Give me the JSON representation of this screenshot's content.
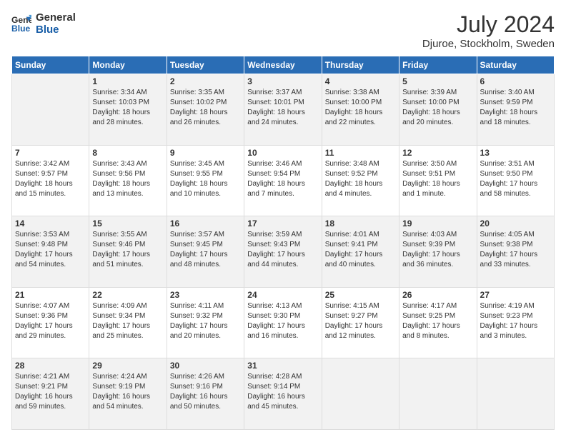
{
  "header": {
    "logo_line1": "General",
    "logo_line2": "Blue",
    "month_year": "July 2024",
    "location": "Djuroe, Stockholm, Sweden"
  },
  "days_of_week": [
    "Sunday",
    "Monday",
    "Tuesday",
    "Wednesday",
    "Thursday",
    "Friday",
    "Saturday"
  ],
  "weeks": [
    [
      {
        "day": "",
        "info": ""
      },
      {
        "day": "1",
        "info": "Sunrise: 3:34 AM\nSunset: 10:03 PM\nDaylight: 18 hours\nand 28 minutes."
      },
      {
        "day": "2",
        "info": "Sunrise: 3:35 AM\nSunset: 10:02 PM\nDaylight: 18 hours\nand 26 minutes."
      },
      {
        "day": "3",
        "info": "Sunrise: 3:37 AM\nSunset: 10:01 PM\nDaylight: 18 hours\nand 24 minutes."
      },
      {
        "day": "4",
        "info": "Sunrise: 3:38 AM\nSunset: 10:00 PM\nDaylight: 18 hours\nand 22 minutes."
      },
      {
        "day": "5",
        "info": "Sunrise: 3:39 AM\nSunset: 10:00 PM\nDaylight: 18 hours\nand 20 minutes."
      },
      {
        "day": "6",
        "info": "Sunrise: 3:40 AM\nSunset: 9:59 PM\nDaylight: 18 hours\nand 18 minutes."
      }
    ],
    [
      {
        "day": "7",
        "info": "Sunrise: 3:42 AM\nSunset: 9:57 PM\nDaylight: 18 hours\nand 15 minutes."
      },
      {
        "day": "8",
        "info": "Sunrise: 3:43 AM\nSunset: 9:56 PM\nDaylight: 18 hours\nand 13 minutes."
      },
      {
        "day": "9",
        "info": "Sunrise: 3:45 AM\nSunset: 9:55 PM\nDaylight: 18 hours\nand 10 minutes."
      },
      {
        "day": "10",
        "info": "Sunrise: 3:46 AM\nSunset: 9:54 PM\nDaylight: 18 hours\nand 7 minutes."
      },
      {
        "day": "11",
        "info": "Sunrise: 3:48 AM\nSunset: 9:52 PM\nDaylight: 18 hours\nand 4 minutes."
      },
      {
        "day": "12",
        "info": "Sunrise: 3:50 AM\nSunset: 9:51 PM\nDaylight: 18 hours\nand 1 minute."
      },
      {
        "day": "13",
        "info": "Sunrise: 3:51 AM\nSunset: 9:50 PM\nDaylight: 17 hours\nand 58 minutes."
      }
    ],
    [
      {
        "day": "14",
        "info": "Sunrise: 3:53 AM\nSunset: 9:48 PM\nDaylight: 17 hours\nand 54 minutes."
      },
      {
        "day": "15",
        "info": "Sunrise: 3:55 AM\nSunset: 9:46 PM\nDaylight: 17 hours\nand 51 minutes."
      },
      {
        "day": "16",
        "info": "Sunrise: 3:57 AM\nSunset: 9:45 PM\nDaylight: 17 hours\nand 48 minutes."
      },
      {
        "day": "17",
        "info": "Sunrise: 3:59 AM\nSunset: 9:43 PM\nDaylight: 17 hours\nand 44 minutes."
      },
      {
        "day": "18",
        "info": "Sunrise: 4:01 AM\nSunset: 9:41 PM\nDaylight: 17 hours\nand 40 minutes."
      },
      {
        "day": "19",
        "info": "Sunrise: 4:03 AM\nSunset: 9:39 PM\nDaylight: 17 hours\nand 36 minutes."
      },
      {
        "day": "20",
        "info": "Sunrise: 4:05 AM\nSunset: 9:38 PM\nDaylight: 17 hours\nand 33 minutes."
      }
    ],
    [
      {
        "day": "21",
        "info": "Sunrise: 4:07 AM\nSunset: 9:36 PM\nDaylight: 17 hours\nand 29 minutes."
      },
      {
        "day": "22",
        "info": "Sunrise: 4:09 AM\nSunset: 9:34 PM\nDaylight: 17 hours\nand 25 minutes."
      },
      {
        "day": "23",
        "info": "Sunrise: 4:11 AM\nSunset: 9:32 PM\nDaylight: 17 hours\nand 20 minutes."
      },
      {
        "day": "24",
        "info": "Sunrise: 4:13 AM\nSunset: 9:30 PM\nDaylight: 17 hours\nand 16 minutes."
      },
      {
        "day": "25",
        "info": "Sunrise: 4:15 AM\nSunset: 9:27 PM\nDaylight: 17 hours\nand 12 minutes."
      },
      {
        "day": "26",
        "info": "Sunrise: 4:17 AM\nSunset: 9:25 PM\nDaylight: 17 hours\nand 8 minutes."
      },
      {
        "day": "27",
        "info": "Sunrise: 4:19 AM\nSunset: 9:23 PM\nDaylight: 17 hours\nand 3 minutes."
      }
    ],
    [
      {
        "day": "28",
        "info": "Sunrise: 4:21 AM\nSunset: 9:21 PM\nDaylight: 16 hours\nand 59 minutes."
      },
      {
        "day": "29",
        "info": "Sunrise: 4:24 AM\nSunset: 9:19 PM\nDaylight: 16 hours\nand 54 minutes."
      },
      {
        "day": "30",
        "info": "Sunrise: 4:26 AM\nSunset: 9:16 PM\nDaylight: 16 hours\nand 50 minutes."
      },
      {
        "day": "31",
        "info": "Sunrise: 4:28 AM\nSunset: 9:14 PM\nDaylight: 16 hours\nand 45 minutes."
      },
      {
        "day": "",
        "info": ""
      },
      {
        "day": "",
        "info": ""
      },
      {
        "day": "",
        "info": ""
      }
    ]
  ]
}
